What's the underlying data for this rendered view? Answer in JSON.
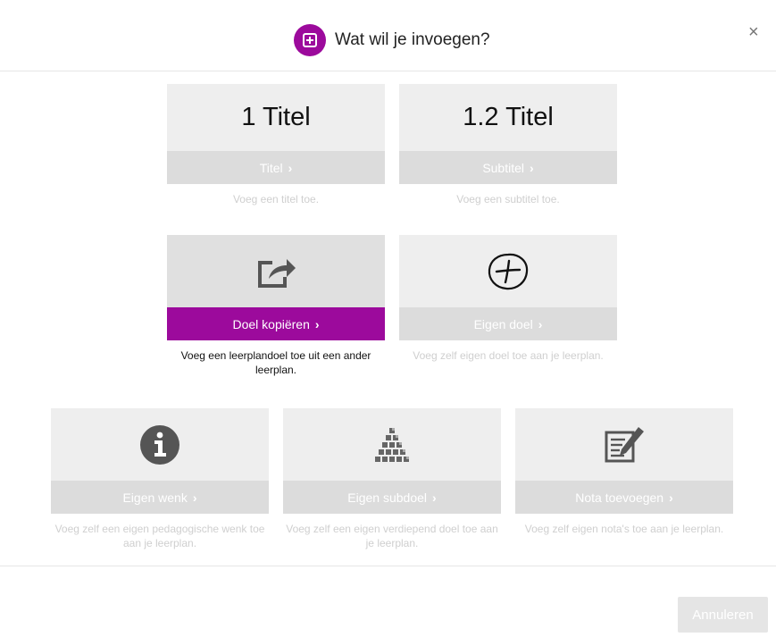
{
  "dialog": {
    "title": "Wat wil je invoegen?",
    "close_label": "×",
    "cancel_label": "Annuleren"
  },
  "cards": [
    {
      "preview": "1 Titel",
      "label": "Titel",
      "desc": "Voeg een titel toe."
    },
    {
      "preview": "1.2 Titel",
      "label": "Subtitel",
      "desc": "Voeg een subtitel toe."
    },
    {
      "icon": "share-export-icon",
      "label": "Doel kopiëren",
      "desc": "Voeg een leerplandoel toe uit een ander leerplan.",
      "selected": true
    },
    {
      "icon": "circled-plus-icon",
      "label": "Eigen doel",
      "desc": "Voeg zelf eigen doel toe aan je leerplan."
    },
    {
      "icon": "info-icon",
      "label": "Eigen wenk",
      "desc": "Voeg zelf een eigen pedagogische wenk toe aan je leerplan."
    },
    {
      "icon": "stacked-cubes-icon",
      "label": "Eigen subdoel",
      "desc": "Voeg zelf een eigen verdiepend doel toe aan je leerplan."
    },
    {
      "icon": "note-edit-icon",
      "label": "Nota toevoegen",
      "desc": "Voeg zelf eigen nota's toe aan je leerplan."
    }
  ],
  "colors": {
    "accent": "#9c0a9c",
    "tile_bg": "#eeeeee",
    "bar_bg": "#dcdcdc"
  }
}
